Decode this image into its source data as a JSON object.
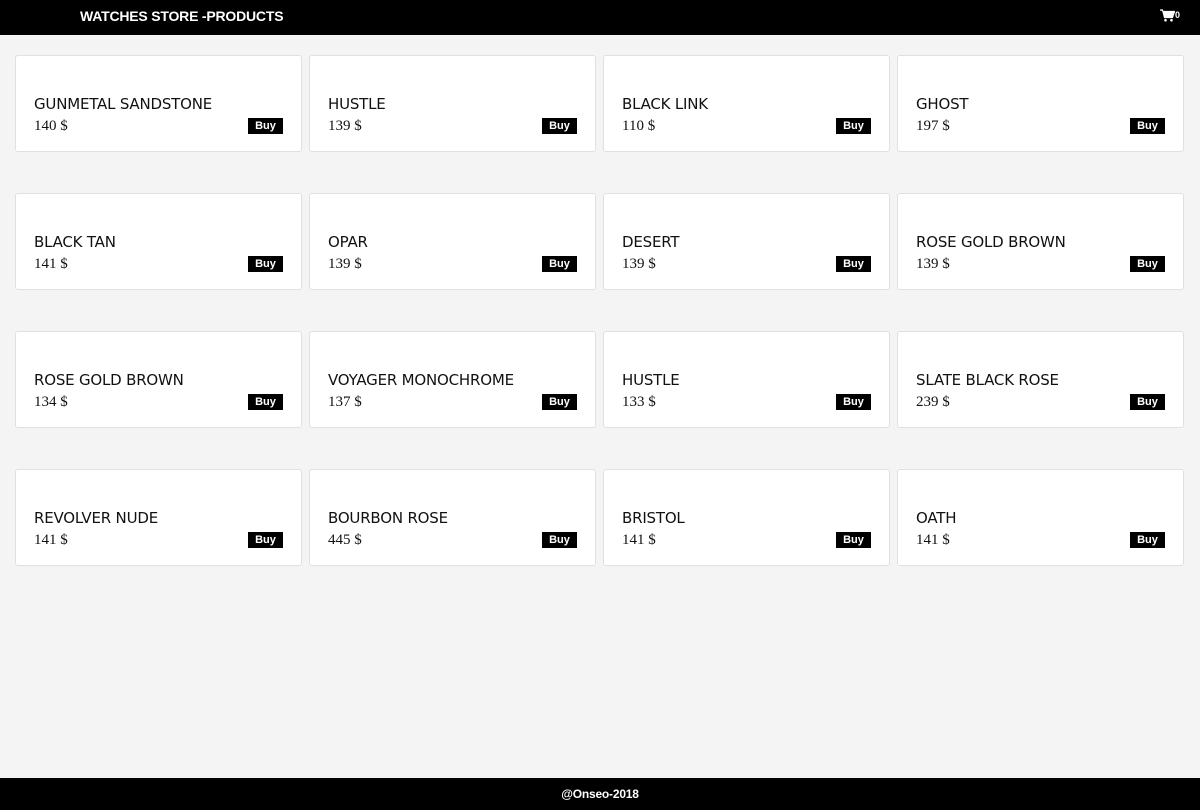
{
  "header": {
    "title": "WATCHES STORE -PRODUCTS",
    "cart_icon": "shopping-cart-icon",
    "cart_count": "0"
  },
  "buy_label": "Buy",
  "products": [
    {
      "name": "GUNMETAL SANDSTONE",
      "price": "140 $"
    },
    {
      "name": "HUSTLE",
      "price": "139 $"
    },
    {
      "name": "BLACK LINK",
      "price": "110 $"
    },
    {
      "name": "GHOST",
      "price": "197 $"
    },
    {
      "name": "BLACK TAN",
      "price": "141 $"
    },
    {
      "name": "OPAR",
      "price": "139 $"
    },
    {
      "name": "DESERT",
      "price": "139 $"
    },
    {
      "name": "ROSE GOLD BROWN",
      "price": "139 $"
    },
    {
      "name": "ROSE GOLD BROWN",
      "price": "134 $"
    },
    {
      "name": "VOYAGER MONOCHROME",
      "price": "137 $"
    },
    {
      "name": "HUSTLE",
      "price": "133 $"
    },
    {
      "name": "SLATE BLACK ROSE",
      "price": "239 $"
    },
    {
      "name": "REVOLVER NUDE",
      "price": "141 $"
    },
    {
      "name": "BOURBON ROSE",
      "price": "445 $"
    },
    {
      "name": "BRISTOL",
      "price": "141 $"
    },
    {
      "name": "OATH",
      "price": "141 $"
    }
  ],
  "footer": {
    "text": "@Onseo-2018"
  },
  "colors": {
    "background": "#f4f4f4",
    "bar": "#000000",
    "card": "#ffffff"
  }
}
